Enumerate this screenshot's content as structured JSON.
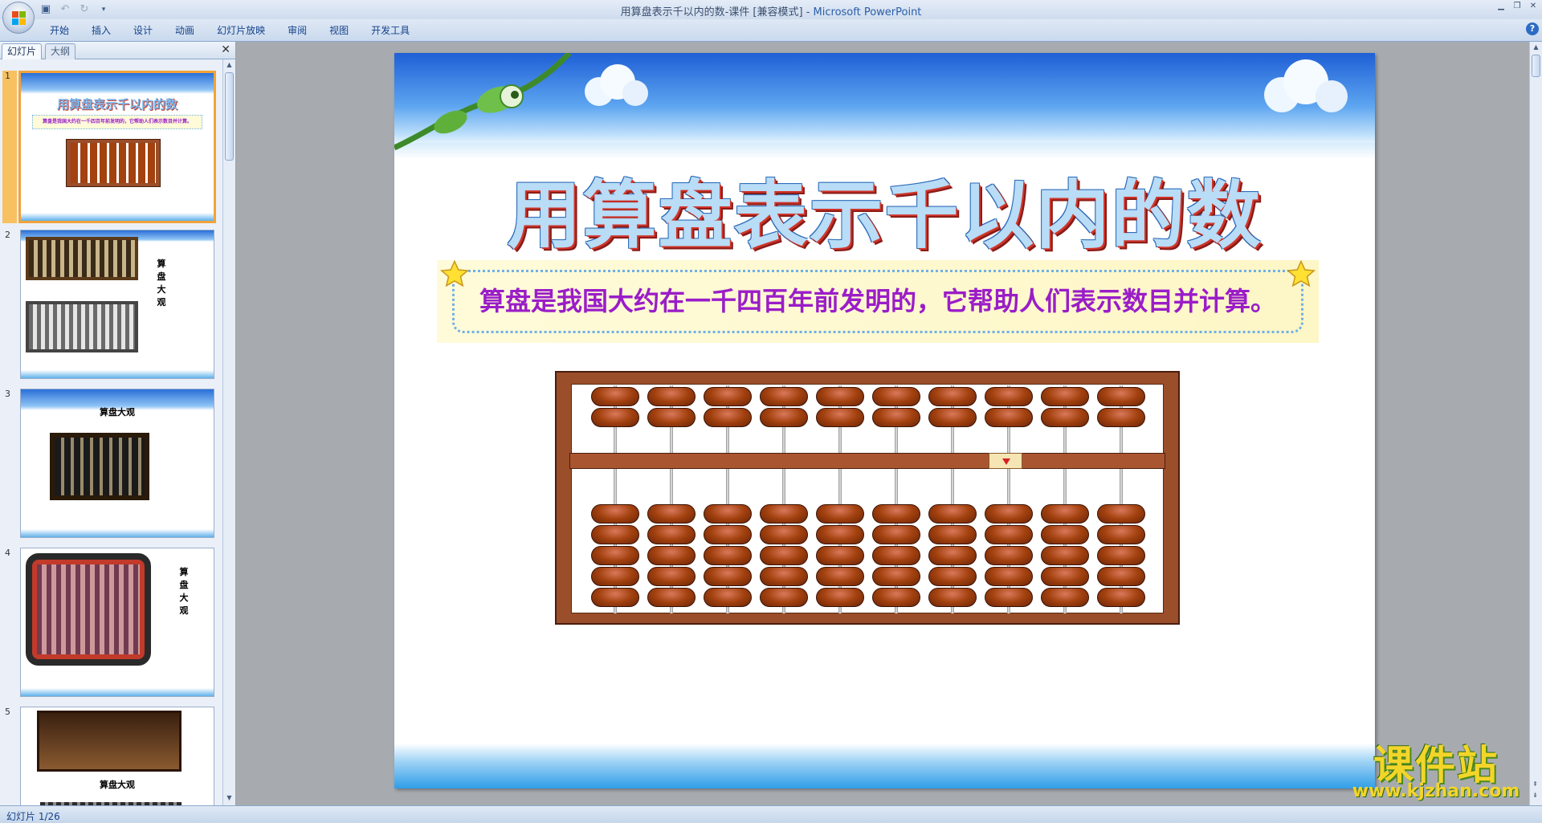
{
  "window": {
    "title": "用算盘表示千以内的数-课件 [兼容模式] - ",
    "app_name": "Microsoft PowerPoint"
  },
  "ribbon": {
    "tabs": [
      "开始",
      "插入",
      "设计",
      "动画",
      "幻灯片放映",
      "审阅",
      "视图",
      "开发工具"
    ]
  },
  "left_pane": {
    "tabs": [
      "幻灯片",
      "大纲"
    ],
    "slides": [
      {
        "number": "1",
        "title": "用算盘表示千以内的数",
        "caption": "算盘是我国大约在一千四百年前发明的，它帮助人们表示数目并计算。"
      },
      {
        "number": "2",
        "side_text": "算盘大观"
      },
      {
        "number": "3",
        "title": "算盘大观"
      },
      {
        "number": "4",
        "side_text": "算盘大观"
      },
      {
        "number": "5",
        "title": "算盘大观"
      }
    ]
  },
  "slide": {
    "title": "用算盘表示千以内的数",
    "banner_text": "算盘是我国大约在一千四百年前发明的，它帮助人们表示数目并计算。",
    "abacus": {
      "rods": 10,
      "upper_beads_per_rod": 2,
      "lower_beads_per_rod": 5,
      "marker_rod": 8
    }
  },
  "status": {
    "slide_indicator": "幻灯片 1/26"
  },
  "watermark": {
    "title": "课件站",
    "url": "www.kjzhan.com"
  },
  "colors": {
    "accent": "#9a1dc8",
    "bead": "#a3410f",
    "frame": "#9a4e2a"
  }
}
